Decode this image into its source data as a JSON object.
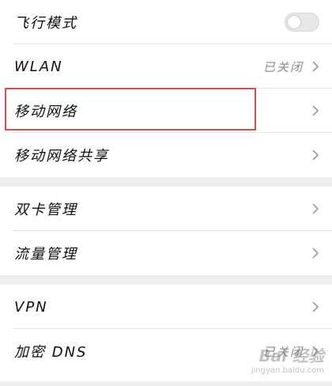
{
  "settings": {
    "section1": [
      {
        "label": "飞行模式",
        "type": "toggle",
        "toggle_on": false
      },
      {
        "label": "WLAN",
        "status": "已关闭"
      },
      {
        "label": "移动网络",
        "highlighted": true
      },
      {
        "label": "移动网络共享"
      }
    ],
    "section2": [
      {
        "label": "双卡管理"
      },
      {
        "label": "流量管理"
      }
    ],
    "section3": [
      {
        "label": "VPN"
      },
      {
        "label": "加密 DNS",
        "status": "已关闭"
      }
    ]
  },
  "watermark": {
    "main": "Bai 经验",
    "sub": "jingyan.baidu.com"
  },
  "colors": {
    "highlight": "#e34b4b",
    "separator": "#eeeeee",
    "status_text": "#8a8a8a"
  },
  "icons": {
    "chevron": "chevron-right-icon"
  }
}
